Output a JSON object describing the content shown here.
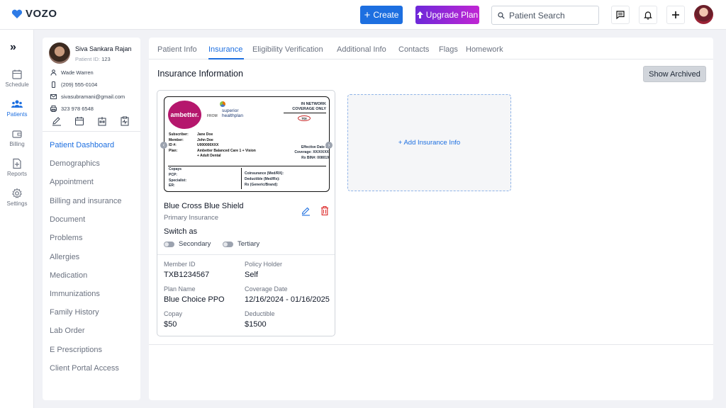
{
  "app": {
    "logo_text": "VOZO"
  },
  "header": {
    "create_label": "Create",
    "upgrade_label": "Upgrade Plan",
    "search_placeholder": "Patient Search"
  },
  "rail": [
    {
      "label": "Schedule",
      "icon": "calendar-icon"
    },
    {
      "label": "Patients",
      "icon": "users-icon",
      "active": true
    },
    {
      "label": "Billing",
      "icon": "wallet-icon"
    },
    {
      "label": "Reports",
      "icon": "report-icon"
    },
    {
      "label": "Settings",
      "icon": "gear-icon"
    }
  ],
  "patient": {
    "name": "Siva Sankara Rajan",
    "id_label": "Patient ID:",
    "id_value": "123",
    "provider": "Wade Warren",
    "phone": "(209) 555-0104",
    "email": "sivasubramani@gmail.com",
    "fax": "323 978 6548"
  },
  "patient_nav": [
    "Patient Dashboard",
    "Demographics",
    "Appointment",
    "Billing and insurance",
    "Document",
    "Problems",
    "Allergies",
    "Medication",
    "Immunizations",
    "Family History",
    "Lab Order",
    "E Prescriptions",
    "Client Portal Access"
  ],
  "tabs": [
    "Patient Info",
    "Insurance",
    "Eligibility Verification",
    "Additional Info",
    "Contacts",
    "Flags",
    "Homework"
  ],
  "active_tab": "Insurance",
  "section_title": "Insurance Information",
  "show_archived_label": "Show Archived",
  "id_card": {
    "brand": "ambetter.",
    "from": "FROM",
    "partner_line1": "superior",
    "partner_line2": "healthplan",
    "network_line1": "IN NETWORK",
    "network_line2": "COVERAGE ONLY",
    "tdi": "TDI",
    "subscriber_label": "Subscriber:",
    "subscriber": "Jane Doe",
    "member_label": "Member:",
    "member": "John Doe",
    "id_label": "ID #:",
    "id": "U000000XXX",
    "plan_label": "Plan:",
    "plan_line1": "Ambetter Balanced Care 1 + Vision",
    "plan_line2": "+ Adult Dental",
    "effective_label": "Effective Date of",
    "coverage": "Coverage: XX/XX/XX",
    "rx_bin": "Rx BIN#: 008019",
    "copays": "Copays",
    "pcp": "PCP:",
    "specialist": "Specialist:",
    "er": "ER:",
    "coinsurance": "Coinsurance (Med/RX):",
    "deductible": "Deductible (Med/Rx):",
    "rx": "Rx (Generic/Brand):"
  },
  "insurance": {
    "name": "Blue Cross Blue Shield",
    "type": "Primary Insurance",
    "switch_as_label": "Switch as",
    "secondary_label": "Secondary",
    "tertiary_label": "Tertiary",
    "secondary_on": false,
    "tertiary_on": false,
    "member_id_label": "Member ID",
    "member_id": "TXB1234567",
    "policy_holder_label": "Policy Holder",
    "policy_holder": "Self",
    "plan_name_label": "Plan Name",
    "plan_name": "Blue Choice PPO",
    "coverage_date_label": "Coverage Date",
    "coverage_date": "12/16/2024 - 01/16/2025",
    "copay_label": "Copay",
    "copay": "$50",
    "deductible_label": "Deductible",
    "deductible": "$1500"
  },
  "add_insurance_label": "+ Add Insurance Info",
  "colors": {
    "accent": "#1d6fe0",
    "brand_ambetter": "#b5176d",
    "delete": "#dc2626"
  }
}
